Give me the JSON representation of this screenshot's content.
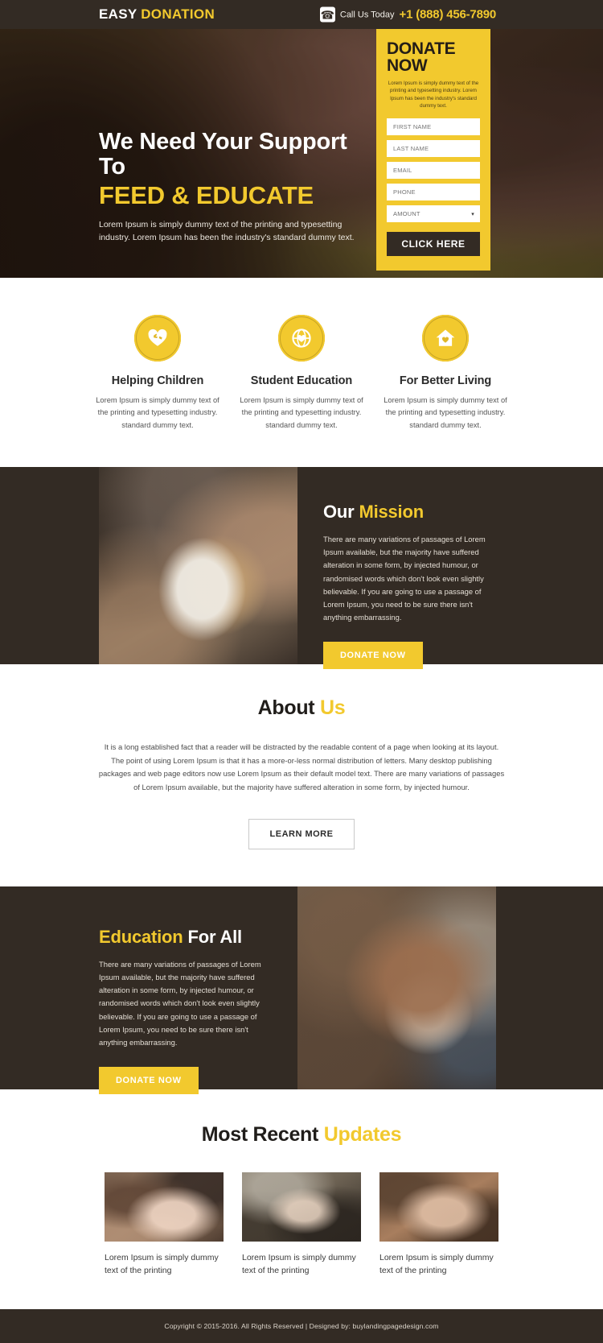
{
  "header": {
    "brand_primary": "EASY",
    "brand_secondary": "DONATION",
    "call_label": "Call Us Today",
    "phone": "+1 (888) 456-7890"
  },
  "hero": {
    "heading_line1": "We Need Your Support To",
    "heading_line2": "FEED & EDUCATE",
    "paragraph": "Lorem Ipsum is simply dummy text of the printing and typesetting industry. Lorem Ipsum has been the industry's standard dummy text."
  },
  "donate_form": {
    "title": "DONATE NOW",
    "subtitle": "Lorem Ipsum is simply dummy text of the printing and typesetting industry. Lorem Ipsum has been the industry's standard dummy text.",
    "fields": [
      {
        "name": "first-name",
        "placeholder": "FIRST NAME",
        "value": ""
      },
      {
        "name": "last-name",
        "placeholder": "LAST NAME",
        "value": ""
      },
      {
        "name": "email",
        "placeholder": "EMAIL",
        "value": ""
      },
      {
        "name": "phone",
        "placeholder": "PHONE",
        "value": ""
      }
    ],
    "amount_label": "AMOUNT",
    "submit_label": "CLICK HERE"
  },
  "features": [
    {
      "icon": "heart-hands-icon",
      "title": "Helping Children",
      "text": "Lorem Ipsum is simply dummy text of the printing and typesetting industry. standard dummy text."
    },
    {
      "icon": "globe-heart-icon",
      "title": "Student Education",
      "text": "Lorem Ipsum is simply dummy text of the printing and typesetting industry. standard dummy text."
    },
    {
      "icon": "home-heart-icon",
      "title": "For Better Living",
      "text": "Lorem Ipsum is simply dummy text of the printing and typesetting industry. standard dummy text."
    }
  ],
  "mission": {
    "heading_white": "Our",
    "heading_yellow": "Mission",
    "paragraph": "There are many variations of passages of Lorem Ipsum available, but the majority have suffered alteration in some form, by injected humour, or randomised words which don't look even slightly believable. If you are going to use a passage of Lorem Ipsum, you need to be sure there isn't anything embarrassing.",
    "button": "DONATE NOW"
  },
  "about": {
    "heading_dark": "About",
    "heading_yellow": "Us",
    "paragraph": "It is a long established fact that a reader will be distracted by the readable content of a page when looking at its layout. The point of using Lorem Ipsum is that it has a more-or-less normal distribution of letters. Many desktop publishing packages and web page editors now use Lorem Ipsum as their default model text. There are many variations of passages of Lorem Ipsum available, but the majority have suffered alteration in some form, by injected humour.",
    "button": "LEARN MORE"
  },
  "education": {
    "heading_yellow": "Education",
    "heading_white": "For All",
    "paragraph": "There are many variations of passages of Lorem Ipsum available, but the majority have suffered alteration in some form, by injected humour, or randomised words which don't look even slightly believable. If you are going to use a passage of Lorem Ipsum, you need to be sure there isn't anything embarrassing.",
    "button": "DONATE NOW"
  },
  "updates": {
    "heading_dark": "Most Recent",
    "heading_yellow": "Updates",
    "cards": [
      {
        "caption": "Lorem Ipsum is simply dummy text of the printing"
      },
      {
        "caption": "Lorem Ipsum is simply dummy text of the printing"
      },
      {
        "caption": "Lorem Ipsum is simply dummy text of the printing"
      }
    ]
  },
  "footer": {
    "text": "Copyright © 2015-2016. All Rights Reserved  |  Designed by: buylandingpagedesign.com"
  },
  "colors": {
    "accent": "#f2c92e",
    "dark": "#332b24",
    "white": "#ffffff"
  }
}
